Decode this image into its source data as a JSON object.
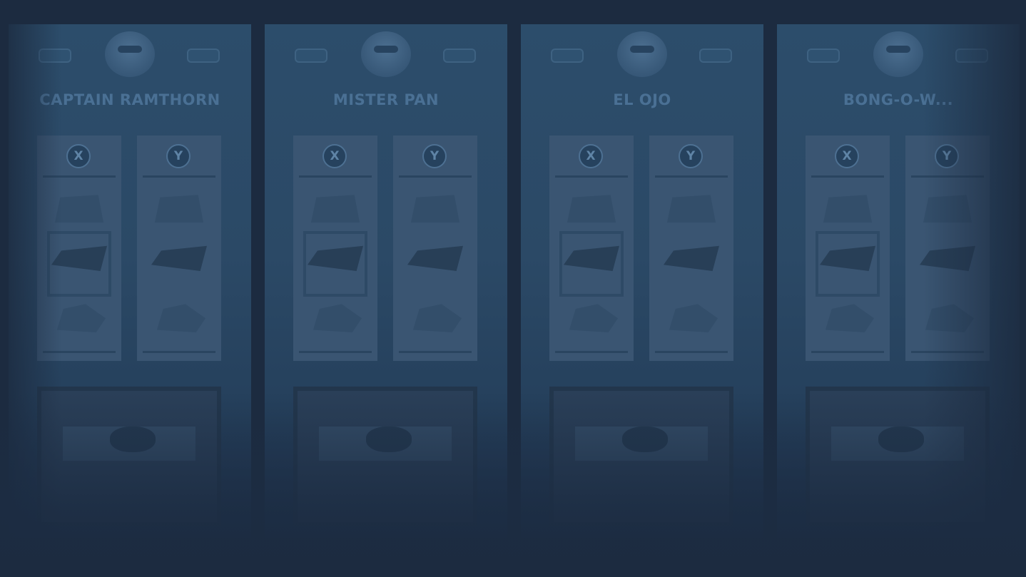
{
  "characters": [
    {
      "name": "CAPTAIN RAMTHORN"
    },
    {
      "name": "MISTER PAN"
    },
    {
      "name": "EL OJO"
    },
    {
      "name": "BONG-O-W..."
    }
  ],
  "columns": [
    "X",
    "Y"
  ],
  "colors": {
    "background": "#1c2b40",
    "panel": "#2c4d6b",
    "column": "#3a5572",
    "text": "#4a7094"
  }
}
